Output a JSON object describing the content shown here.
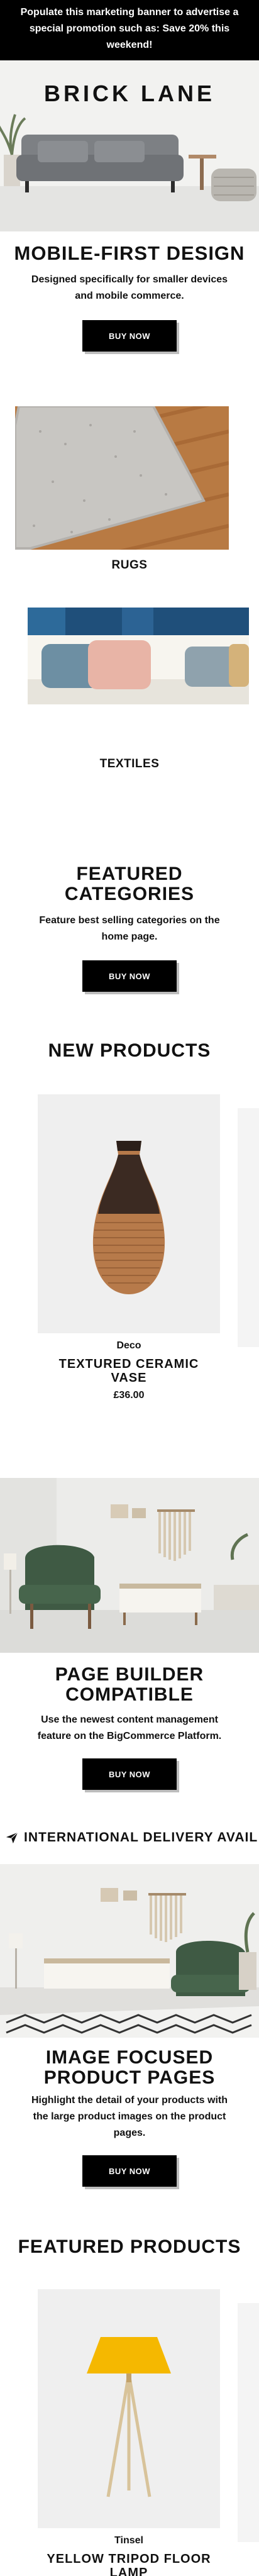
{
  "promo": {
    "line1": "Populate this marketing banner to advertise a",
    "line2": "special promotion such as: Save 20% this",
    "line3": "weekend!"
  },
  "brand": {
    "logo": "BRICK LANE"
  },
  "hero": {
    "title": "MOBILE-FIRST DESIGN",
    "sub1": "Designed specifically for smaller devices",
    "sub2": "and mobile commerce.",
    "button": "BUY NOW"
  },
  "categories": [
    {
      "label": "RUGS"
    },
    {
      "label": "TEXTILES"
    }
  ],
  "featured_categories": {
    "title1": "FEATURED",
    "title2": "CATEGORIES",
    "sub1": "Feature best selling categories on the",
    "sub2": "home page.",
    "button": "BUY NOW"
  },
  "new_products": {
    "title": "NEW PRODUCTS",
    "item": {
      "brand": "Deco",
      "name1": "TEXTURED CERAMIC",
      "name2": "VASE",
      "price": "£36.00"
    }
  },
  "page_builder": {
    "title1": "PAGE BUILDER",
    "title2": "COMPATIBLE",
    "sub1": "Use the newest content management",
    "sub2": "feature on the BigCommerce Platform.",
    "button": "BUY NOW"
  },
  "ticker": {
    "text": "INTERNATIONAL DELIVERY AVAIL"
  },
  "image_focused": {
    "title1": "IMAGE FOCUSED",
    "title2": "PRODUCT PAGES",
    "sub1": "Highlight the detail of your products with",
    "sub2": "the large product images on the product",
    "sub3": "pages.",
    "button": "BUY NOW"
  },
  "featured_products": {
    "title": "FEATURED PRODUCTS",
    "item": {
      "brand": "Tinsel",
      "name1": "YELLOW TRIPOD FLOOR",
      "name2": "LAMP"
    }
  },
  "colors": {
    "banner_bg": "#000000",
    "lamp": "#f5b800",
    "sofa_green": "#3f5a44"
  }
}
